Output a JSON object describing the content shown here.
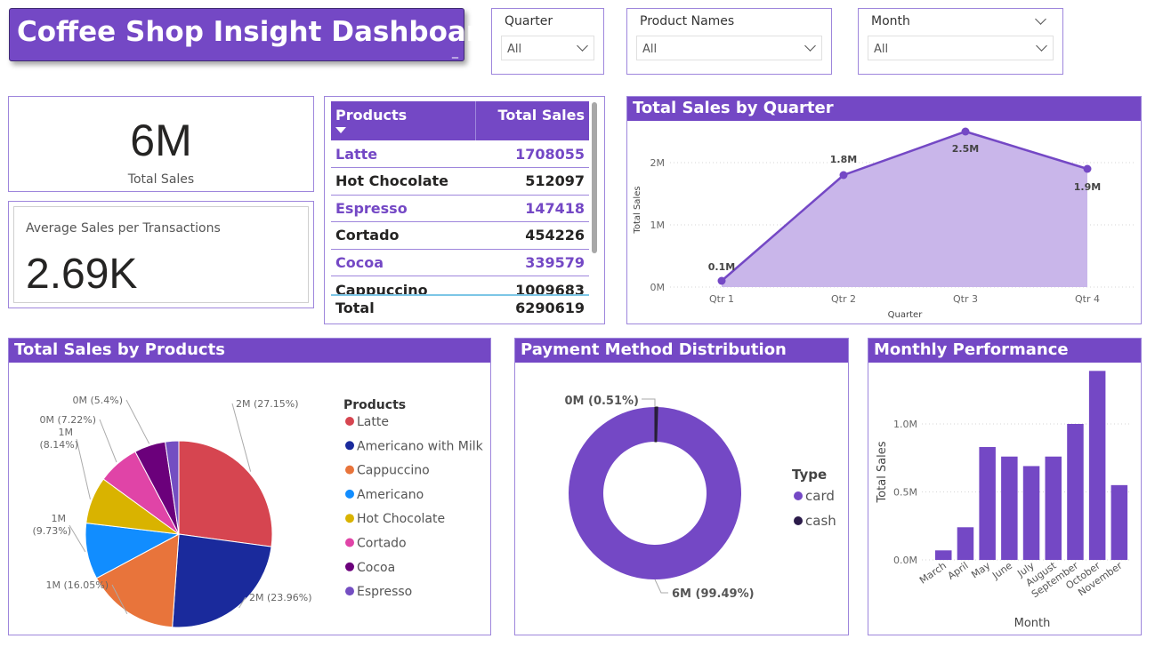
{
  "header": {
    "title": "Coffee Shop Insight Dashboard",
    "minimize": "_"
  },
  "filters": [
    {
      "label": "Quarter",
      "value": "All"
    },
    {
      "label": "Product Names",
      "value": "All"
    },
    {
      "label": "Month",
      "value": "All"
    }
  ],
  "kpi": {
    "total_sales_value": "6M",
    "total_sales_label": "Total Sales",
    "avg_label": "Average Sales per Transactions",
    "avg_value": "2.69K"
  },
  "products_table": {
    "headers": [
      "Products",
      "Total Sales"
    ],
    "rows": [
      {
        "name": "Latte",
        "value": "1708055"
      },
      {
        "name": "Hot Chocolate",
        "value": "512097"
      },
      {
        "name": "Espresso",
        "value": "147418"
      },
      {
        "name": "Cortado",
        "value": "454226"
      },
      {
        "name": "Cocoa",
        "value": "339579"
      },
      {
        "name": "Cappuccino",
        "value": "1009683"
      }
    ],
    "total_label": "Total",
    "total_value": "6290619"
  },
  "panels": {
    "quarter_title": "Total Sales by Quarter",
    "products_title": "Total Sales by Products",
    "payment_title": "Payment Method Distribution",
    "monthly_title": "Monthly Performance"
  },
  "colors": {
    "accent": "#7448c5",
    "area_fill": "#c9b6ea",
    "latte": "#d64550",
    "americano_milk": "#1a2a9c",
    "cappuccino": "#e8743b",
    "americano": "#118dff",
    "hot_chocolate": "#d9b300",
    "cortado": "#e044a7",
    "cocoa": "#6b007b",
    "espresso": "#744ec2",
    "cash": "#2b1b4a"
  },
  "chart_data": [
    {
      "type": "area",
      "title": "Total Sales by Quarter",
      "xlabel": "Quarter",
      "ylabel": "Total Sales",
      "categories": [
        "Qtr 1",
        "Qtr 2",
        "Qtr 3",
        "Qtr 4"
      ],
      "values": [
        0.1,
        1.8,
        2.5,
        1.9
      ],
      "data_labels": [
        "0.1M",
        "1.8M",
        "2.5M",
        "1.9M"
      ],
      "y_ticks": [
        "0M",
        "1M",
        "2M"
      ],
      "ylim": [
        0,
        2.7
      ],
      "grid": true
    },
    {
      "type": "pie",
      "title": "Total Sales by Products",
      "legend_title": "Products",
      "legend_position": "right",
      "categories": [
        "Latte",
        "Americano with Milk",
        "Cappuccino",
        "Americano",
        "Hot Chocolate",
        "Cortado",
        "Cocoa",
        "Espresso"
      ],
      "values": [
        27.15,
        23.96,
        16.05,
        9.73,
        8.14,
        7.22,
        5.4,
        2.34
      ],
      "data_labels": [
        "2M (27.15%)",
        "2M (23.96%)",
        "1M (16.05%)",
        "1M (9.73%)",
        "1M (8.14%)",
        "0M (7.22%)",
        "0M (5.4%)",
        ""
      ]
    },
    {
      "type": "pie",
      "title": "Payment Method Distribution",
      "legend_title": "Type",
      "legend_position": "right",
      "categories": [
        "card",
        "cash"
      ],
      "values": [
        99.49,
        0.51
      ],
      "data_labels": [
        "6M (99.49%)",
        "0M (0.51%)"
      ]
    },
    {
      "type": "bar",
      "title": "Monthly Performance",
      "xlabel": "Month",
      "ylabel": "Total Sales",
      "categories": [
        "March",
        "April",
        "May",
        "June",
        "July",
        "August",
        "September",
        "October",
        "November"
      ],
      "values": [
        0.07,
        0.24,
        0.83,
        0.76,
        0.69,
        0.76,
        1.0,
        1.39,
        0.55
      ],
      "y_ticks": [
        "0.0M",
        "0.5M",
        "1.0M"
      ],
      "ylim": [
        0,
        1.45
      ],
      "grid": true
    }
  ]
}
